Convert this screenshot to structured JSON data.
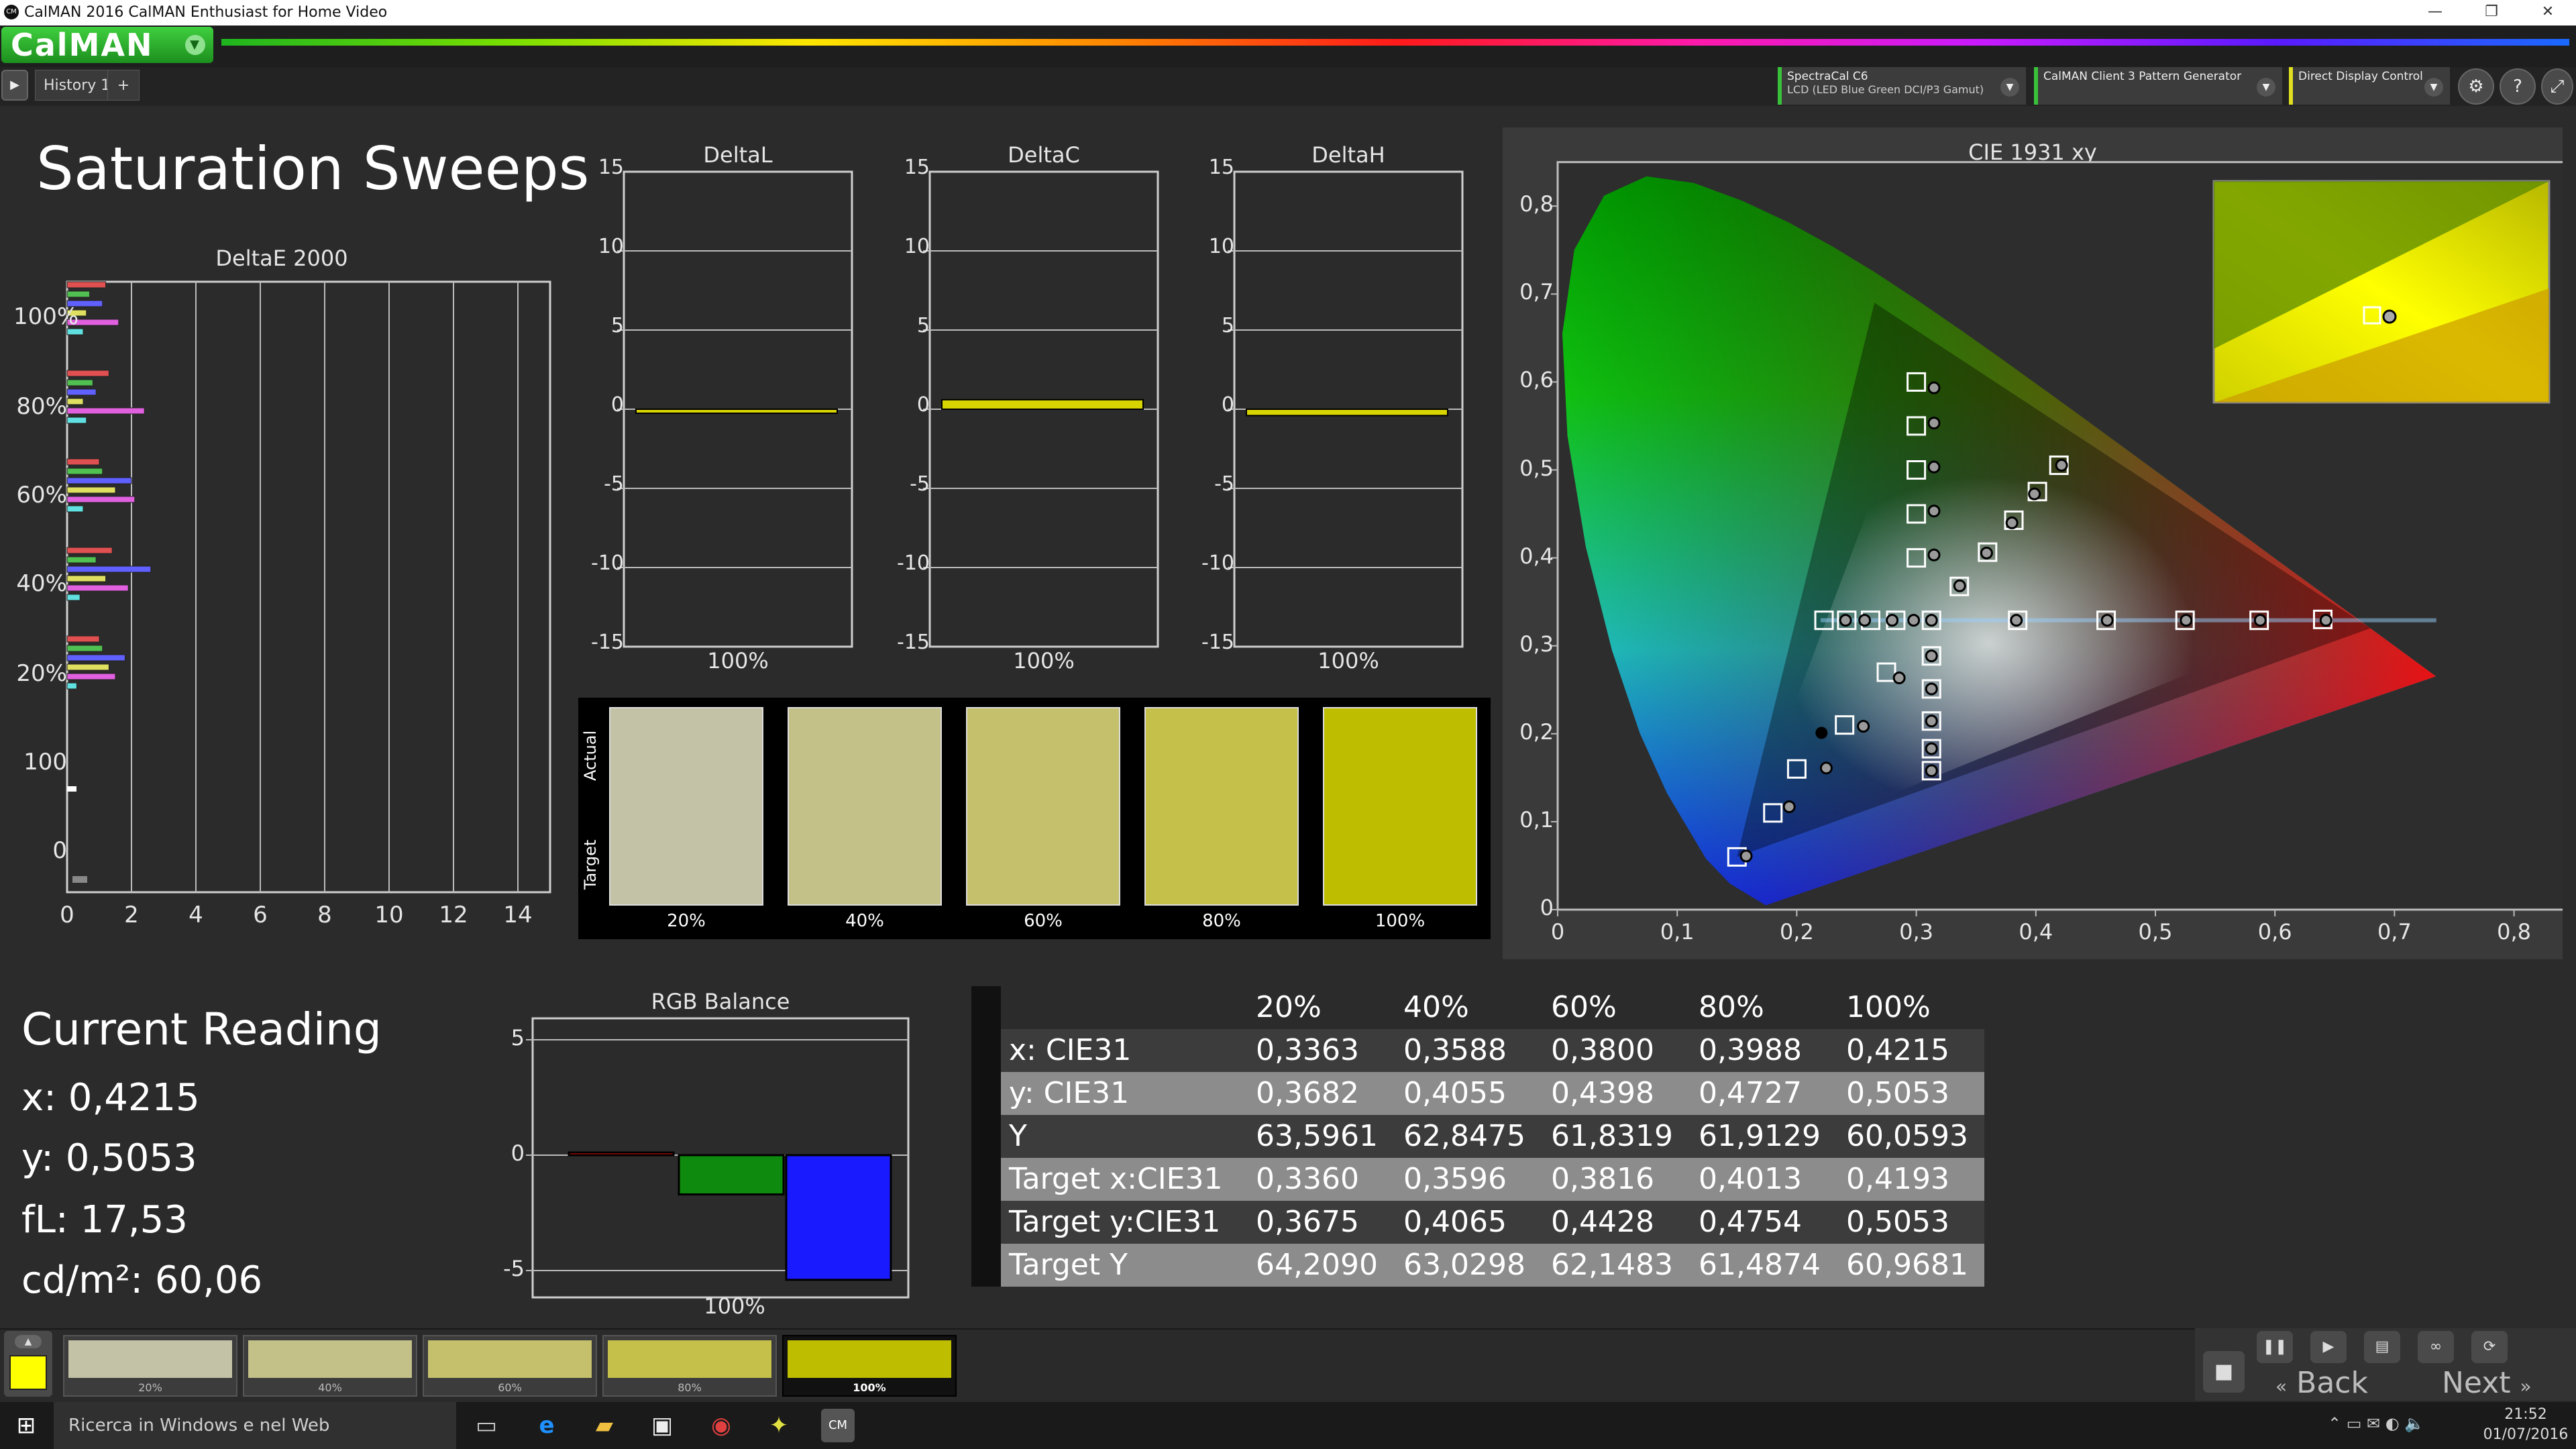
{
  "window": {
    "title": "CalMAN 2016 CalMAN Enthusiast for Home Video",
    "app_icon": "CM"
  },
  "brand": {
    "logo": "CalMAN"
  },
  "tabs": [
    {
      "label": "History 1"
    }
  ],
  "devices": [
    {
      "line1": "SpectraCal C6",
      "line2": "LCD (LED Blue Green DCI/P3 Gamut)"
    },
    {
      "line1": "CalMAN Client 3 Pattern Generator",
      "line2": ""
    },
    {
      "line1": "Direct Display Control",
      "line2": ""
    }
  ],
  "page": {
    "title": "Saturation Sweeps"
  },
  "deltae": {
    "title": "DeltaE 2000",
    "ytick_labels": [
      "100%",
      "80%",
      "60%",
      "40%",
      "20%",
      "100",
      "0"
    ],
    "xtick_labels": [
      "0",
      "2",
      "4",
      "6",
      "8",
      "10",
      "12",
      "14"
    ]
  },
  "delta_charts": [
    {
      "title": "DeltaL",
      "value": -0.1,
      "xlabel": "100%",
      "ticks": [
        "15",
        "10",
        "5",
        "0",
        "-5",
        "-10",
        "-15"
      ]
    },
    {
      "title": "DeltaC",
      "value": 0.6,
      "xlabel": "100%",
      "ticks": [
        "15",
        "10",
        "5",
        "0",
        "-5",
        "-10",
        "-15"
      ]
    },
    {
      "title": "DeltaH",
      "value": -0.4,
      "xlabel": "100%",
      "ticks": [
        "15",
        "10",
        "5",
        "0",
        "-5",
        "-10",
        "-15"
      ]
    }
  ],
  "swatches": {
    "actual_label": "Actual",
    "target_label": "Target",
    "items": [
      {
        "label": "20%",
        "color": "#c3c2a6"
      },
      {
        "label": "40%",
        "color": "#c3c088"
      },
      {
        "label": "60%",
        "color": "#c4c06c"
      },
      {
        "label": "80%",
        "color": "#c4c04a"
      },
      {
        "label": "100%",
        "color": "#bfbd00"
      }
    ]
  },
  "cie": {
    "title": "CIE 1931 xy",
    "xtick_labels": [
      "0",
      "0,1",
      "0,2",
      "0,3",
      "0,4",
      "0,5",
      "0,6",
      "0,7",
      "0,8"
    ],
    "ytick_labels": [
      "0",
      "0,1",
      "0,2",
      "0,3",
      "0,4",
      "0,5",
      "0,6",
      "0,7",
      "0,8"
    ]
  },
  "current_reading": {
    "title": "Current Reading",
    "x": "x: 0,4215",
    "y": "y: 0,5053",
    "fl": "fL: 17,53",
    "cdm2": "cd/m²: 60,06"
  },
  "rgb_balance": {
    "title": "RGB Balance",
    "xlabel": "100%",
    "ticks": [
      "5",
      "0",
      "-5"
    ],
    "colors": {
      "red": "#e01010",
      "green": "#0e8a0e",
      "blue": "#1a1aff"
    }
  },
  "chart_data": [
    {
      "type": "bar",
      "title": "RGB Balance",
      "categories": [
        "100%"
      ],
      "series": [
        {
          "name": "R",
          "values": [
            0.1
          ]
        },
        {
          "name": "G",
          "values": [
            -1.7
          ]
        },
        {
          "name": "B",
          "values": [
            -5.4
          ]
        }
      ],
      "ylim": [
        -5.5,
        5.5
      ]
    },
    {
      "type": "scatter",
      "title": "CIE 1931 xy",
      "xlim": [
        0,
        0.85
      ],
      "ylim": [
        0,
        0.85
      ],
      "series": [
        {
          "name": "measured",
          "points": [
            [
              0.3363,
              0.3682
            ],
            [
              0.3588,
              0.4055
            ],
            [
              0.38,
              0.4398
            ],
            [
              0.3988,
              0.4727
            ],
            [
              0.4215,
              0.5053
            ],
            [
              0.3148,
              0.5933
            ],
            [
              0.3148,
              0.5533
            ],
            [
              0.3148,
              0.5033
            ],
            [
              0.3148,
              0.4533
            ],
            [
              0.3148,
              0.4033
            ],
            [
              0.3127,
              0.329
            ],
            [
              0.2978,
              0.329
            ],
            [
              0.2798,
              0.329
            ],
            [
              0.2568,
              0.329
            ],
            [
              0.2408,
              0.329
            ],
            [
              0.3837,
              0.329
            ],
            [
              0.4597,
              0.329
            ],
            [
              0.5257,
              0.329
            ],
            [
              0.5877,
              0.329
            ],
            [
              0.6427,
              0.329
            ],
            [
              0.3127,
              0.2885
            ],
            [
              0.3127,
              0.251
            ],
            [
              0.3127,
              0.2145
            ],
            [
              0.3127,
              0.183
            ],
            [
              0.3127,
              0.158
            ],
            [
              0.2857,
              0.2635
            ],
            [
              0.2557,
              0.2085
            ],
            [
              0.2247,
              0.161
            ],
            [
              0.1937,
              0.117
            ],
            [
              0.1577,
              0.061
            ]
          ]
        },
        {
          "name": "target",
          "points": [
            [
              0.336,
              0.3675
            ],
            [
              0.3596,
              0.4065
            ],
            [
              0.3816,
              0.4428
            ],
            [
              0.4013,
              0.4754
            ],
            [
              0.4193,
              0.5053
            ],
            [
              0.3,
              0.6
            ],
            [
              0.3,
              0.55
            ],
            [
              0.3,
              0.5
            ],
            [
              0.3,
              0.45
            ],
            [
              0.3,
              0.4
            ],
            [
              0.3127,
              0.329
            ],
            [
              0.2228,
              0.329
            ],
            [
              0.2418,
              0.329
            ],
            [
              0.2618,
              0.329
            ],
            [
              0.2828,
              0.329
            ],
            [
              0.3848,
              0.329
            ],
            [
              0.4588,
              0.329
            ],
            [
              0.5248,
              0.329
            ],
            [
              0.5868,
              0.329
            ],
            [
              0.64,
              0.33
            ],
            [
              0.3127,
              0.2885
            ],
            [
              0.3127,
              0.251
            ],
            [
              0.3127,
              0.2145
            ],
            [
              0.3127,
              0.183
            ],
            [
              0.3127,
              0.158
            ],
            [
              0.275,
              0.27
            ],
            [
              0.24,
              0.21
            ],
            [
              0.2,
              0.16
            ],
            [
              0.18,
              0.11
            ],
            [
              0.15,
              0.06
            ]
          ]
        }
      ]
    },
    {
      "type": "bar",
      "title": "DeltaE 2000",
      "orientation": "horizontal",
      "groups": [
        "100%",
        "80%",
        "60%",
        "40%",
        "20%"
      ],
      "series_colors": [
        "#e05050",
        "#50c050",
        "#6060ff",
        "#e0e060",
        "#e060e0",
        "#60e0e0"
      ],
      "values": [
        [
          1.2,
          0.7,
          1.1,
          0.6,
          1.6,
          0.5
        ],
        [
          1.3,
          0.8,
          0.9,
          0.5,
          2.4,
          0.6
        ],
        [
          1.0,
          1.1,
          2.0,
          1.5,
          2.1,
          0.5
        ],
        [
          1.4,
          0.9,
          2.6,
          1.2,
          1.9,
          0.4
        ],
        [
          1.0,
          1.1,
          1.8,
          1.3,
          1.5,
          0.3
        ]
      ],
      "xlim": [
        0,
        15
      ]
    }
  ],
  "readings_table": {
    "columns": [
      "",
      "20%",
      "40%",
      "60%",
      "80%",
      "100%"
    ],
    "rows": [
      {
        "label": "x: CIE31",
        "values": [
          "0,3363",
          "0,3588",
          "0,3800",
          "0,3988",
          "0,4215"
        ]
      },
      {
        "label": "y: CIE31",
        "values": [
          "0,3682",
          "0,4055",
          "0,4398",
          "0,4727",
          "0,5053"
        ]
      },
      {
        "label": "Y",
        "values": [
          "63,5961",
          "62,8475",
          "61,8319",
          "61,9129",
          "60,0593"
        ]
      },
      {
        "label": "Target x:CIE31",
        "values": [
          "0,3360",
          "0,3596",
          "0,3816",
          "0,4013",
          "0,4193"
        ]
      },
      {
        "label": "Target y:CIE31",
        "values": [
          "0,3675",
          "0,4065",
          "0,4428",
          "0,4754",
          "0,5053"
        ]
      },
      {
        "label": "Target Y",
        "values": [
          "64,2090",
          "63,0298",
          "62,1483",
          "61,4874",
          "60,9681"
        ]
      }
    ]
  },
  "patches": [
    {
      "label": "",
      "color": "#ffff00"
    },
    {
      "label": "20%",
      "color": "#c3c2a6"
    },
    {
      "label": "40%",
      "color": "#c3c088"
    },
    {
      "label": "60%",
      "color": "#c4c06c"
    },
    {
      "label": "80%",
      "color": "#c4c04a"
    },
    {
      "label": "100%",
      "color": "#bfbd00"
    }
  ],
  "nav": {
    "back": "Back",
    "next": "Next"
  },
  "taskbar": {
    "search_placeholder": "Ricerca in Windows e nel Web",
    "time": "21:52",
    "date": "01/07/2016"
  }
}
